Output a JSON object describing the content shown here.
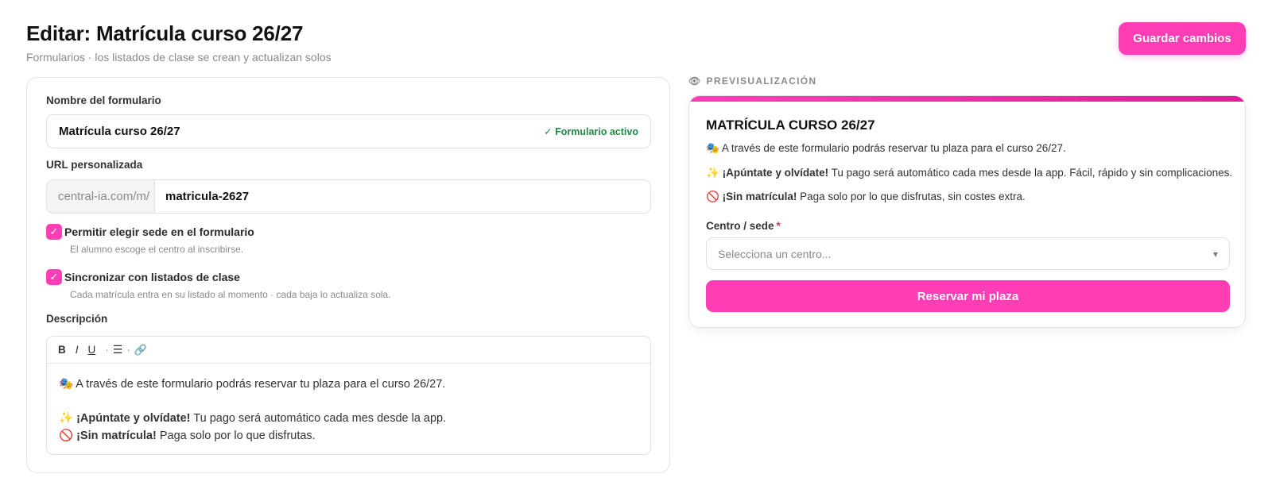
{
  "header": {
    "title": "Editar: Matrícula curso 26/27",
    "subtitle": "Formularios · los listados de clase se crean y actualizan solos",
    "save_label": "Guardar cambios"
  },
  "editor": {
    "name_label": "Nombre del formulario",
    "name_value": "Matrícula curso 26/27",
    "active_badge": "✓ Formulario activo",
    "url_label": "URL personalizada",
    "url_prefix": "central-ia.com/m/",
    "url_slug": "matricula-2627",
    "options": [
      {
        "checked": true,
        "label": "Permitir elegir sede en el formulario",
        "help": "El alumno escoge el centro al inscribirse."
      },
      {
        "checked": true,
        "label": "Sincronizar con listados de clase",
        "help": "Cada matrícula entra en su listado al momento · cada baja lo actualiza sola."
      }
    ],
    "check_glyph": "✓",
    "description_label": "Descripción",
    "toolbar": {
      "bold": "B",
      "italic": "I",
      "underline": "U",
      "sep": "·",
      "list": "☰",
      "link": "🔗"
    },
    "description": {
      "line1": "🎭 A través de este formulario podrás reservar tu plaza para el curso 26/27.",
      "line2_emoji": "✨",
      "line2_bold": "¡Apúntate y olvídate!",
      "line2_rest": "Tu pago será automático cada mes desde la app.",
      "line3_emoji": "🚫",
      "line3_bold": "¡Sin matrícula!",
      "line3_rest": "Paga solo por lo que disfrutas."
    }
  },
  "preview": {
    "label": "PREVISUALIZACIÓN",
    "eye_icon": "👁",
    "title": "MATRÍCULA CURSO 26/27",
    "line1": "🎭 A través de este formulario podrás reservar tu plaza para el curso 26/27.",
    "line2_emoji": "✨",
    "line2_bold": "¡Apúntate y olvídate!",
    "line2_rest": "Tu pago será automático cada mes desde la app. Fácil, rápido y sin complicaciones.",
    "line3_emoji": "🚫",
    "line3_bold": "¡Sin matrícula!",
    "line3_rest": "Paga solo por lo que disfrutas, sin costes extra.",
    "field_label": "Centro / sede",
    "required_mark": "*",
    "select_placeholder": "Selecciona un centro...",
    "select_arrow": "▾",
    "submit_label": "Reservar mi plaza"
  },
  "colors": {
    "accent": "#ff3eb5",
    "success": "#1e8a44",
    "required": "#e0245e"
  }
}
